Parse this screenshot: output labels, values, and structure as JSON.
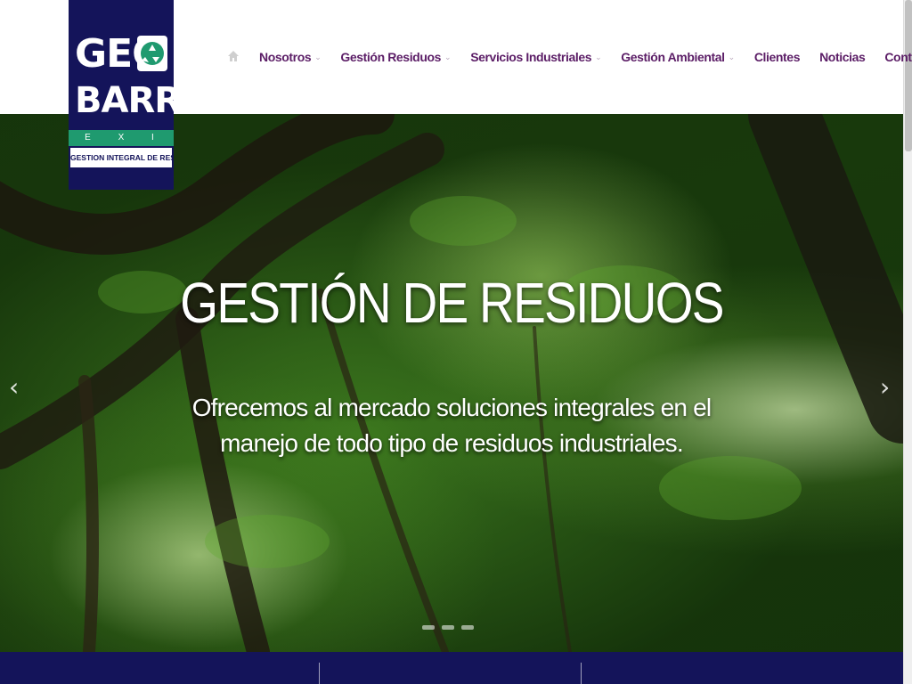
{
  "logo": {
    "line1": "GEO",
    "line2": "BARRA",
    "line3": "E X I N S",
    "tagline": "GESTION INTEGRAL DE RESIDUOS",
    "icon": "recycle-icon"
  },
  "nav": {
    "home_icon": "home-icon",
    "items": [
      {
        "label": "Nosotros",
        "has_submenu": true
      },
      {
        "label": "Gestión Residuos",
        "has_submenu": true
      },
      {
        "label": "Servicios Industriales",
        "has_submenu": true
      },
      {
        "label": "Gestión Ambiental",
        "has_submenu": true
      },
      {
        "label": "Clientes",
        "has_submenu": false
      },
      {
        "label": "Noticias",
        "has_submenu": false
      },
      {
        "label": "Contacto",
        "has_submenu": false
      }
    ],
    "chevron": "⌄"
  },
  "hero": {
    "title": "GESTIÓN DE RESIDUOS",
    "subtitle": "Ofrecemos al mercado soluciones integrales en el manejo de todo tipo de residuos industriales.",
    "prev_icon": "‹",
    "next_icon": "›",
    "slide_count": 3,
    "active_slide": 1
  },
  "colors": {
    "brand_navy": "#14145a",
    "brand_green": "#1f9a6f",
    "nav_text": "#5b1d66"
  }
}
